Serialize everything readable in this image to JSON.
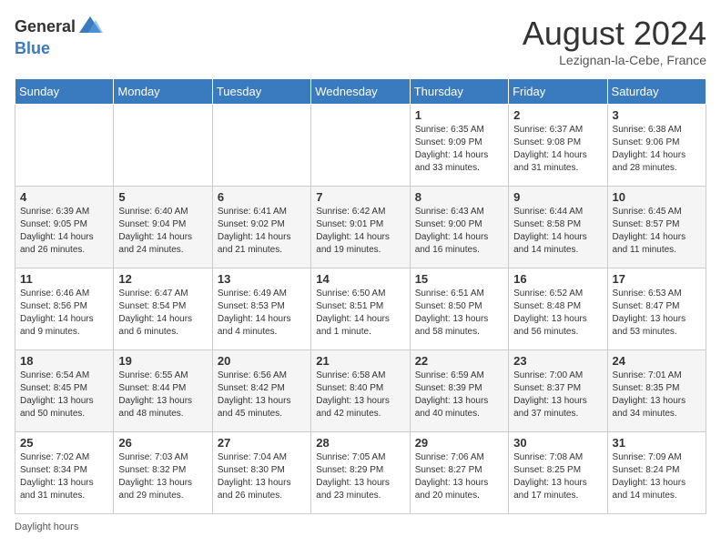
{
  "header": {
    "logo_general": "General",
    "logo_blue": "Blue",
    "month_title": "August 2024",
    "subtitle": "Lezignan-la-Cebe, France"
  },
  "columns": [
    "Sunday",
    "Monday",
    "Tuesday",
    "Wednesday",
    "Thursday",
    "Friday",
    "Saturday"
  ],
  "weeks": [
    [
      {
        "day": "",
        "info": ""
      },
      {
        "day": "",
        "info": ""
      },
      {
        "day": "",
        "info": ""
      },
      {
        "day": "",
        "info": ""
      },
      {
        "day": "1",
        "info": "Sunrise: 6:35 AM\nSunset: 9:09 PM\nDaylight: 14 hours and 33 minutes."
      },
      {
        "day": "2",
        "info": "Sunrise: 6:37 AM\nSunset: 9:08 PM\nDaylight: 14 hours and 31 minutes."
      },
      {
        "day": "3",
        "info": "Sunrise: 6:38 AM\nSunset: 9:06 PM\nDaylight: 14 hours and 28 minutes."
      }
    ],
    [
      {
        "day": "4",
        "info": "Sunrise: 6:39 AM\nSunset: 9:05 PM\nDaylight: 14 hours and 26 minutes."
      },
      {
        "day": "5",
        "info": "Sunrise: 6:40 AM\nSunset: 9:04 PM\nDaylight: 14 hours and 24 minutes."
      },
      {
        "day": "6",
        "info": "Sunrise: 6:41 AM\nSunset: 9:02 PM\nDaylight: 14 hours and 21 minutes."
      },
      {
        "day": "7",
        "info": "Sunrise: 6:42 AM\nSunset: 9:01 PM\nDaylight: 14 hours and 19 minutes."
      },
      {
        "day": "8",
        "info": "Sunrise: 6:43 AM\nSunset: 9:00 PM\nDaylight: 14 hours and 16 minutes."
      },
      {
        "day": "9",
        "info": "Sunrise: 6:44 AM\nSunset: 8:58 PM\nDaylight: 14 hours and 14 minutes."
      },
      {
        "day": "10",
        "info": "Sunrise: 6:45 AM\nSunset: 8:57 PM\nDaylight: 14 hours and 11 minutes."
      }
    ],
    [
      {
        "day": "11",
        "info": "Sunrise: 6:46 AM\nSunset: 8:56 PM\nDaylight: 14 hours and 9 minutes."
      },
      {
        "day": "12",
        "info": "Sunrise: 6:47 AM\nSunset: 8:54 PM\nDaylight: 14 hours and 6 minutes."
      },
      {
        "day": "13",
        "info": "Sunrise: 6:49 AM\nSunset: 8:53 PM\nDaylight: 14 hours and 4 minutes."
      },
      {
        "day": "14",
        "info": "Sunrise: 6:50 AM\nSunset: 8:51 PM\nDaylight: 14 hours and 1 minute."
      },
      {
        "day": "15",
        "info": "Sunrise: 6:51 AM\nSunset: 8:50 PM\nDaylight: 13 hours and 58 minutes."
      },
      {
        "day": "16",
        "info": "Sunrise: 6:52 AM\nSunset: 8:48 PM\nDaylight: 13 hours and 56 minutes."
      },
      {
        "day": "17",
        "info": "Sunrise: 6:53 AM\nSunset: 8:47 PM\nDaylight: 13 hours and 53 minutes."
      }
    ],
    [
      {
        "day": "18",
        "info": "Sunrise: 6:54 AM\nSunset: 8:45 PM\nDaylight: 13 hours and 50 minutes."
      },
      {
        "day": "19",
        "info": "Sunrise: 6:55 AM\nSunset: 8:44 PM\nDaylight: 13 hours and 48 minutes."
      },
      {
        "day": "20",
        "info": "Sunrise: 6:56 AM\nSunset: 8:42 PM\nDaylight: 13 hours and 45 minutes."
      },
      {
        "day": "21",
        "info": "Sunrise: 6:58 AM\nSunset: 8:40 PM\nDaylight: 13 hours and 42 minutes."
      },
      {
        "day": "22",
        "info": "Sunrise: 6:59 AM\nSunset: 8:39 PM\nDaylight: 13 hours and 40 minutes."
      },
      {
        "day": "23",
        "info": "Sunrise: 7:00 AM\nSunset: 8:37 PM\nDaylight: 13 hours and 37 minutes."
      },
      {
        "day": "24",
        "info": "Sunrise: 7:01 AM\nSunset: 8:35 PM\nDaylight: 13 hours and 34 minutes."
      }
    ],
    [
      {
        "day": "25",
        "info": "Sunrise: 7:02 AM\nSunset: 8:34 PM\nDaylight: 13 hours and 31 minutes."
      },
      {
        "day": "26",
        "info": "Sunrise: 7:03 AM\nSunset: 8:32 PM\nDaylight: 13 hours and 29 minutes."
      },
      {
        "day": "27",
        "info": "Sunrise: 7:04 AM\nSunset: 8:30 PM\nDaylight: 13 hours and 26 minutes."
      },
      {
        "day": "28",
        "info": "Sunrise: 7:05 AM\nSunset: 8:29 PM\nDaylight: 13 hours and 23 minutes."
      },
      {
        "day": "29",
        "info": "Sunrise: 7:06 AM\nSunset: 8:27 PM\nDaylight: 13 hours and 20 minutes."
      },
      {
        "day": "30",
        "info": "Sunrise: 7:08 AM\nSunset: 8:25 PM\nDaylight: 13 hours and 17 minutes."
      },
      {
        "day": "31",
        "info": "Sunrise: 7:09 AM\nSunset: 8:24 PM\nDaylight: 13 hours and 14 minutes."
      }
    ]
  ],
  "footer": {
    "daylight_label": "Daylight hours"
  }
}
